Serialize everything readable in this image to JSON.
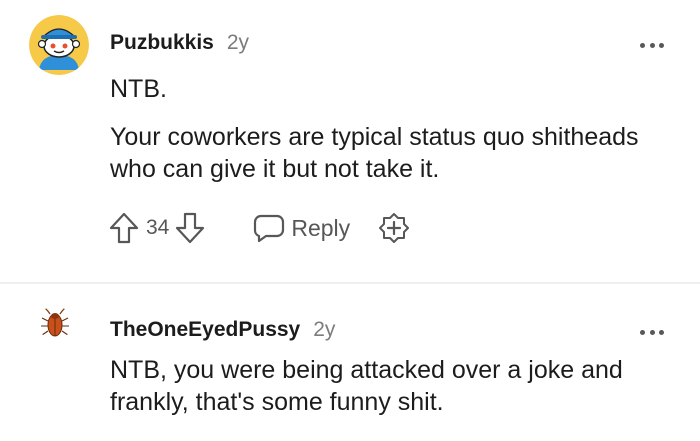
{
  "comments": [
    {
      "username": "Puzbukkis",
      "age": "2y",
      "paragraphs": [
        "NTB.",
        "Your coworkers are typical status quo shitheads who can give it but not take it."
      ],
      "votes": "34",
      "reply_label": "Reply",
      "avatar": "snoo-blue-cap-avatar"
    },
    {
      "username": "TheOneEyedPussy",
      "age": "2y",
      "paragraphs": [
        "NTB, you were being attacked over a joke and frankly, that's some funny shit."
      ],
      "avatar": "cockroach-avatar"
    }
  ],
  "icons": {
    "upvote": "upvote-arrow-icon",
    "downvote": "downvote-arrow-icon",
    "reply": "speech-bubble-icon",
    "award": "award-plus-icon",
    "more": "more-options-icon"
  },
  "colors": {
    "text": "#1c1c1c",
    "muted": "#7c7c7c",
    "divider": "#edeff1",
    "avatar_bg": "#f7c948"
  }
}
